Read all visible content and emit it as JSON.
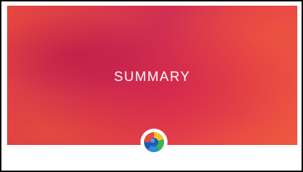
{
  "slide": {
    "title": "SUMMARY",
    "logo_icon": "app-logo-icon",
    "colors": {
      "hero_gradient": [
        "#e5473f",
        "#d02f52",
        "#e33b4a",
        "#ee5a3e"
      ],
      "title_text": "#ffffff",
      "footer_background": "#ffffff",
      "logo_colors": [
        "#1e5bb8",
        "#3ab54a",
        "#f2c230",
        "#e84a3a"
      ]
    }
  }
}
